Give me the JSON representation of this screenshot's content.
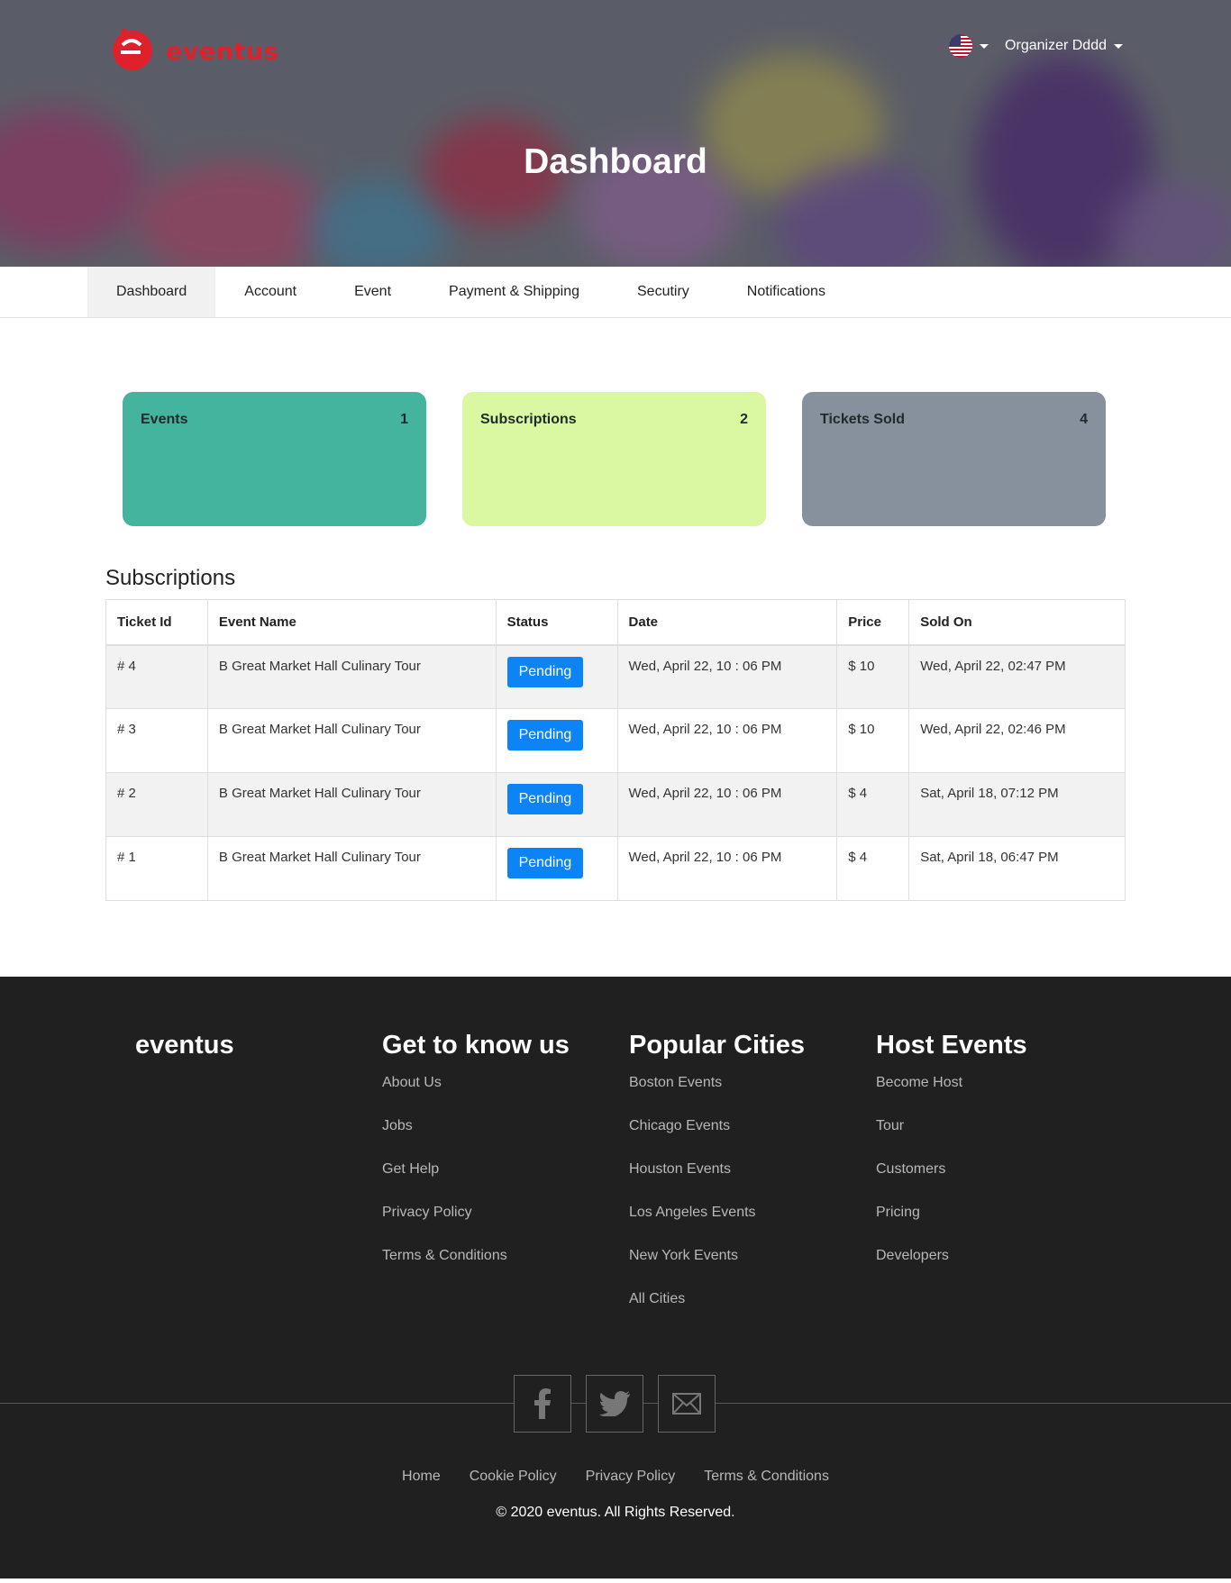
{
  "brand": {
    "name": "eventus",
    "color": "#e0202a"
  },
  "header": {
    "user_name": "Organizer Dddd",
    "lang_icon": "us-flag-icon"
  },
  "hero": {
    "title": "Dashboard"
  },
  "tabs": [
    {
      "label": "Dashboard",
      "active": true
    },
    {
      "label": "Account"
    },
    {
      "label": "Event"
    },
    {
      "label": "Payment & Shipping"
    },
    {
      "label": "Secutiry"
    },
    {
      "label": "Notifications"
    }
  ],
  "stats": [
    {
      "label": "Events",
      "value": "1",
      "color": "#45b49f"
    },
    {
      "label": "Subscriptions",
      "value": "2",
      "color": "#daf7a2"
    },
    {
      "label": "Tickets Sold",
      "value": "4",
      "color": "#87919e"
    }
  ],
  "subscriptions": {
    "heading": "Subscriptions",
    "columns": [
      "Ticket Id",
      "Event Name",
      "Status",
      "Date",
      "Price",
      "Sold On"
    ],
    "rows": [
      {
        "id": "# 4",
        "event": "B Great Market Hall Culinary Tour",
        "status": "Pending",
        "date": "Wed, April 22, 10 : 06 PM",
        "price": "$ 10",
        "sold_on": "Wed, April 22, 02:47 PM"
      },
      {
        "id": "# 3",
        "event": "B Great Market Hall Culinary Tour",
        "status": "Pending",
        "date": "Wed, April 22, 10 : 06 PM",
        "price": "$ 10",
        "sold_on": "Wed, April 22, 02:46 PM"
      },
      {
        "id": "# 2",
        "event": "B Great Market Hall Culinary Tour",
        "status": "Pending",
        "date": "Wed, April 22, 10 : 06 PM",
        "price": "$ 4",
        "sold_on": "Sat, April 18, 07:12 PM"
      },
      {
        "id": "# 1",
        "event": "B Great Market Hall Culinary Tour",
        "status": "Pending",
        "date": "Wed, April 22, 10 : 06 PM",
        "price": "$ 4",
        "sold_on": "Sat, April 18, 06:47 PM"
      }
    ],
    "status_color": "#0d84f6"
  },
  "footer": {
    "brand": "eventus",
    "columns": [
      {
        "title": "Get to know us",
        "links": [
          "About Us",
          "Jobs",
          "Get Help",
          "Privacy Policy",
          "Terms & Conditions"
        ]
      },
      {
        "title": "Popular Cities",
        "links": [
          "Boston Events",
          "Chicago Events",
          "Houston Events",
          "Los Angeles Events",
          "New York Events",
          "All Cities"
        ]
      },
      {
        "title": "Host Events",
        "links": [
          "Become Host",
          "Tour",
          "Customers",
          "Pricing",
          "Developers"
        ]
      }
    ],
    "social": [
      "facebook-icon",
      "twitter-icon",
      "mail-icon"
    ],
    "bottom_links": [
      "Home",
      "Cookie Policy",
      "Privacy Policy",
      "Terms & Conditions"
    ],
    "copyright": "© 2020 eventus. All Rights Reserved."
  }
}
